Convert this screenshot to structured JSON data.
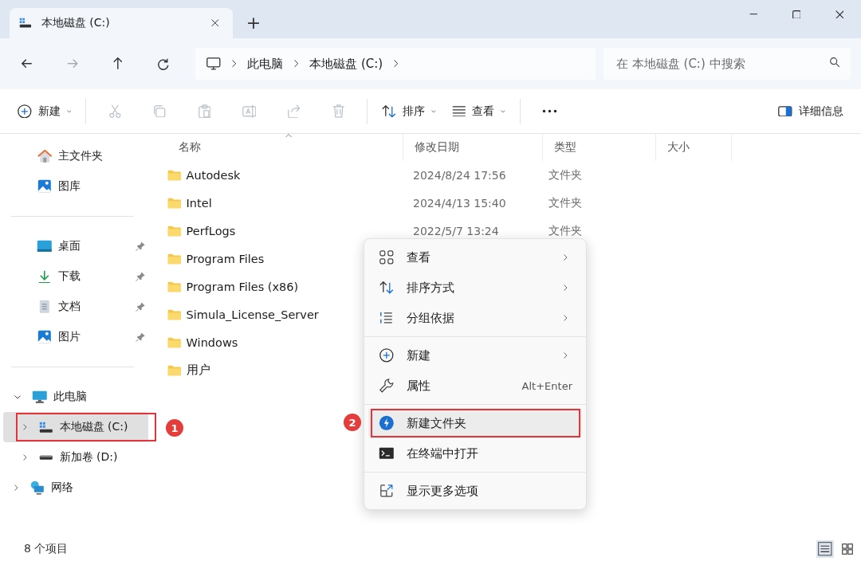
{
  "window": {
    "tab_title": "本地磁盘 (C:)",
    "new_tab": "+"
  },
  "nav": {
    "breadcrumb": [
      "此电脑",
      "本地磁盘 (C:)"
    ],
    "search": {
      "placeholder": "在 本地磁盘 (C:) 中搜索"
    }
  },
  "toolbar": {
    "items": [
      {
        "kind": "dropdown",
        "label": "新建"
      },
      {
        "kind": "icon",
        "disabled": true
      },
      {
        "kind": "icon",
        "disabled": true
      },
      {
        "kind": "icon",
        "disabled": true
      },
      {
        "kind": "icon",
        "disabled": true
      },
      {
        "kind": "icon",
        "disabled": true
      },
      {
        "kind": "icon",
        "disabled": true
      },
      {
        "kind": "dropdown",
        "label": "排序"
      },
      {
        "kind": "dropdown",
        "label": "查看"
      },
      {
        "kind": "more"
      }
    ],
    "details": {
      "label": "详细信息"
    }
  },
  "sidebar": {
    "quick": [
      {
        "label": "主文件夹"
      },
      {
        "label": "图库"
      }
    ],
    "pinned": [
      {
        "label": "桌面",
        "pinned": true
      },
      {
        "label": "下载",
        "pinned": true
      },
      {
        "label": "文档",
        "pinned": true
      },
      {
        "label": "图片",
        "pinned": true
      }
    ],
    "tree": [
      {
        "label": "此电脑",
        "expanded": true,
        "selected": false,
        "children": [
          {
            "label": "本地磁盘 (C:)",
            "expanded": false,
            "selected": true
          },
          {
            "label": "新加卷 (D:)",
            "expanded": false,
            "selected": false
          }
        ]
      },
      {
        "label": "网络",
        "expanded": false,
        "selected": false
      }
    ]
  },
  "table": {
    "columns": [
      {
        "label": "名称",
        "sorted": true
      },
      {
        "label": "修改日期",
        "sorted": false
      },
      {
        "label": "类型",
        "sorted": false
      },
      {
        "label": "大小",
        "sorted": false
      }
    ],
    "rows": [
      {
        "name": "Autodesk",
        "modified": "2024/8/24 17:56",
        "type": "文件夹"
      },
      {
        "name": "Intel",
        "modified": "2024/4/13 15:40",
        "type": "文件夹"
      },
      {
        "name": "PerfLogs",
        "modified": "2022/5/7 13:24",
        "type": "文件夹"
      },
      {
        "name": "Program Files"
      },
      {
        "name": "Program Files (x86)"
      },
      {
        "name": "Simula_License_Server"
      },
      {
        "name": "Windows"
      },
      {
        "name": "用户"
      }
    ]
  },
  "context_menu": {
    "groups": [
      [
        {
          "label": "查看",
          "kind": "submenu",
          "selected": false
        },
        {
          "label": "排序方式",
          "kind": "submenu",
          "selected": false
        },
        {
          "label": "分组依据",
          "kind": "submenu",
          "selected": false
        }
      ],
      [
        {
          "label": "新建",
          "kind": "submenu",
          "selected": false
        },
        {
          "label": "属性",
          "kind": "shortcut",
          "shortcut": "Alt+Enter",
          "selected": false
        }
      ],
      [
        {
          "label": "新建文件夹",
          "kind": "plain",
          "selected": true
        },
        {
          "label": "在终端中打开",
          "kind": "plain",
          "selected": false
        }
      ],
      [
        {
          "label": "显示更多选项",
          "kind": "plain",
          "selected": false
        }
      ]
    ]
  },
  "annotations": [
    {
      "number": "1"
    },
    {
      "number": "2"
    }
  ],
  "status_bar": {
    "count": "8 个项目",
    "views": [
      {
        "selected": true
      },
      {
        "selected": false
      }
    ]
  }
}
